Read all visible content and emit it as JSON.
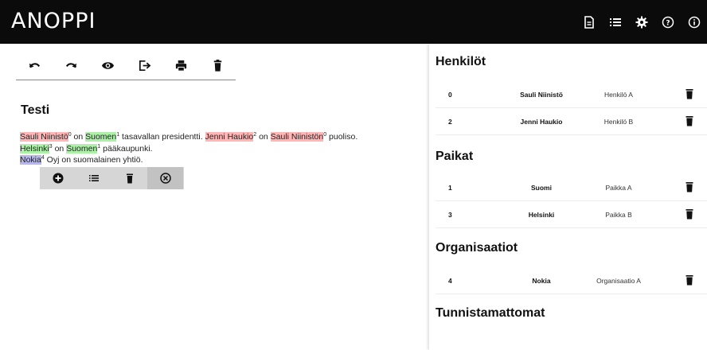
{
  "app": {
    "title": "ANOPPI"
  },
  "topbar_icons": [
    "document-icon",
    "list-icon",
    "settings-icon",
    "help-icon",
    "info-icon"
  ],
  "toolbar_icons": [
    "undo-icon",
    "redo-icon",
    "preview-icon",
    "export-icon",
    "print-icon",
    "delete-icon"
  ],
  "document": {
    "title": "Testi",
    "line1": {
      "e1": "Sauli Niinistö",
      "s1": "0",
      "t1": " on ",
      "e2": "Suomen",
      "s2": "1",
      "t2": " tasavallan presidentti. ",
      "e3": "Jenni Haukio",
      "s3": "2",
      "t3": " on ",
      "e4": "Sauli Niinistön",
      "s4": "0",
      "t4": " puoliso."
    },
    "line2": {
      "e1": "Helsinki",
      "s1": "3",
      "t1": " on ",
      "e2": "Suomen",
      "s2": "1",
      "t2": " pääkaupunki."
    },
    "line3": {
      "e1": "Nokia",
      "s1": "4",
      "t1": " Oyj on suomalainen yhtiö."
    }
  },
  "context_menu_icons": [
    "add-icon",
    "list-icon",
    "delete-icon",
    "close-icon"
  ],
  "colors": {
    "person": "#ffb6b6",
    "place": "#aef0aa",
    "organization": "#b8b8e8",
    "topbar": "#0b0b0b"
  },
  "panel": {
    "persons": {
      "title": "Henkilöt",
      "rows": [
        {
          "id": "0",
          "name": "Sauli Niinistö",
          "label": "Henkilö A"
        },
        {
          "id": "2",
          "name": "Jenni Haukio",
          "label": "Henkilö B"
        }
      ]
    },
    "places": {
      "title": "Paikat",
      "rows": [
        {
          "id": "1",
          "name": "Suomi",
          "label": "Paikka A"
        },
        {
          "id": "3",
          "name": "Helsinki",
          "label": "Paikka B"
        }
      ]
    },
    "orgs": {
      "title": "Organisaatiot",
      "rows": [
        {
          "id": "4",
          "name": "Nokia",
          "label": "Organisaatio A"
        }
      ]
    },
    "unknown": {
      "title": "Tunnistamattomat"
    }
  }
}
